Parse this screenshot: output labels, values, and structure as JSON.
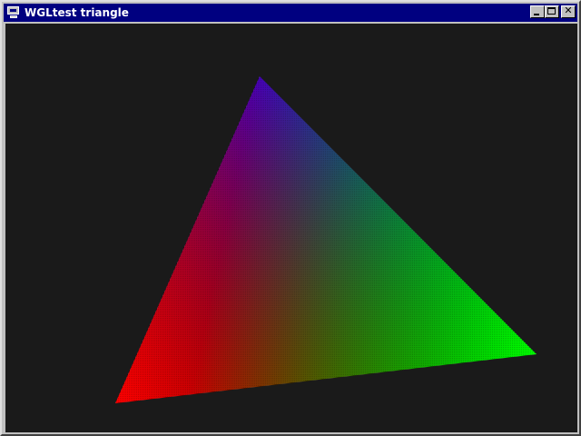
{
  "window": {
    "title": "WGLtest triangle",
    "icon": "computer-icon",
    "buttons": {
      "minimize": "minimize-icon",
      "maximize": "maximize-icon",
      "close": "close-icon",
      "close_glyph": "✕"
    }
  },
  "scene": {
    "background_color": "#000000",
    "triangle": {
      "vertex_colors": [
        "#0000ff",
        "#ff0000",
        "#00ff00"
      ]
    }
  }
}
